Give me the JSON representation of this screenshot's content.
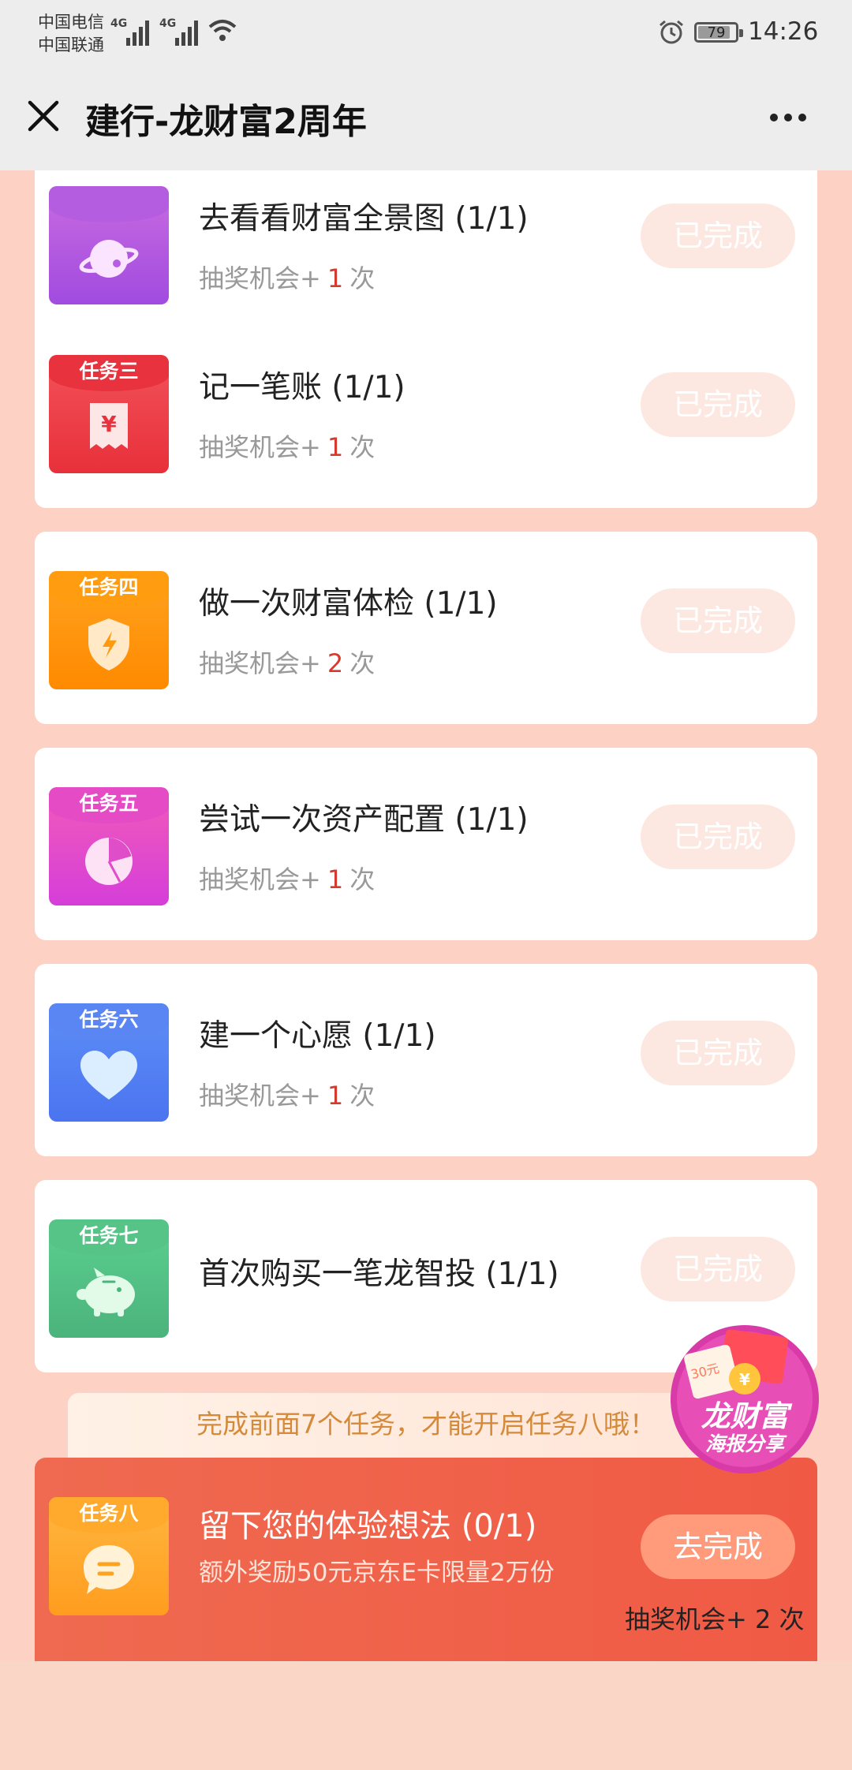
{
  "status_bar": {
    "carrier1": "中国电信",
    "carrier2": "中国联通",
    "net1": "4G",
    "net2": "4G",
    "battery": "79",
    "time": "14:26"
  },
  "nav": {
    "title": "建行-龙财富2周年"
  },
  "tasks": [
    {
      "tag": "",
      "name": "去看看财富全景图 (1/1)",
      "reward_prefix": "抽奖机会+",
      "reward_count": "1",
      "reward_suffix": "次",
      "button": "已完成",
      "color_top": "#c96be0",
      "color_bottom": "#a14be0",
      "icon": "planet-icon"
    },
    {
      "tag": "任务三",
      "name": "记一笔账 (1/1)",
      "reward_prefix": "抽奖机会+",
      "reward_count": "1",
      "reward_suffix": "次",
      "button": "已完成",
      "color_top": "#f2525a",
      "color_bottom": "#e8303a",
      "icon": "receipt-icon"
    },
    {
      "tag": "任务四",
      "name": "做一次财富体检 (1/1)",
      "reward_prefix": "抽奖机会+",
      "reward_count": "2",
      "reward_suffix": "次",
      "button": "已完成",
      "color_top": "#ffa21f",
      "color_bottom": "#ff8a00",
      "icon": "shield-icon"
    },
    {
      "tag": "任务五",
      "name": "尝试一次资产配置 (1/1)",
      "reward_prefix": "抽奖机会+",
      "reward_count": "1",
      "reward_suffix": "次",
      "button": "已完成",
      "color_top": "#f25bb8",
      "color_bottom": "#d53ed9",
      "icon": "pie-chart-icon"
    },
    {
      "tag": "任务六",
      "name": "建一个心愿 (1/1)",
      "reward_prefix": "抽奖机会+",
      "reward_count": "1",
      "reward_suffix": "次",
      "button": "已完成",
      "color_top": "#5d8ff6",
      "color_bottom": "#4b74f0",
      "icon": "heart-icon"
    },
    {
      "tag": "任务七",
      "name": "首次购买一笔龙智投 (1/1)",
      "reward_prefix": "",
      "reward_count": "",
      "reward_suffix": "",
      "button": "已完成",
      "color_top": "#5cd08f",
      "color_bottom": "#4bb37c",
      "icon": "piggy-bank-icon"
    }
  ],
  "notice": "完成前面7个任务，才能开启任务八哦！",
  "task8": {
    "tag": "任务八",
    "name": "留下您的体验想法 (0/1)",
    "subtitle": "额外奖励50元京东E卡限量2万份",
    "button": "去完成",
    "reward": "抽奖机会+ 2 次"
  },
  "poster": {
    "line1": "龙财富",
    "line2": "海报分享",
    "coupon": "30元"
  }
}
